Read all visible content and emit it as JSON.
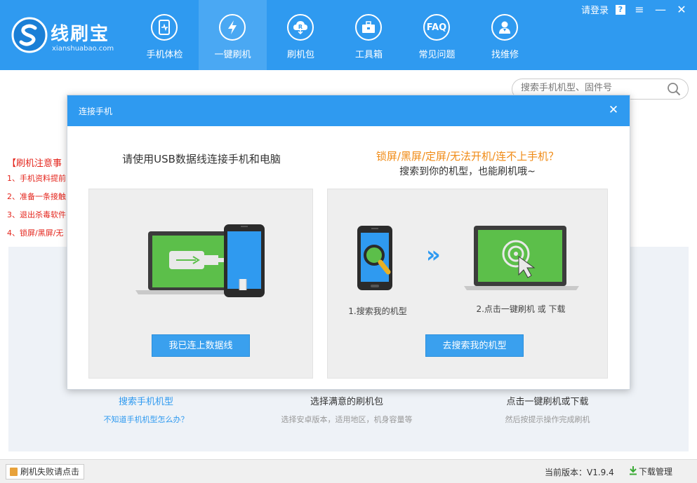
{
  "header": {
    "brand": {
      "name": "线刷宝",
      "domain": "xianshuabao.com"
    },
    "nav": [
      {
        "label": "手机体检",
        "icon": "phone-check-icon"
      },
      {
        "label": "一键刷机",
        "icon": "flash-bolt-icon"
      },
      {
        "label": "刷机包",
        "icon": "rom-package-icon"
      },
      {
        "label": "工具箱",
        "icon": "toolbox-icon"
      },
      {
        "label": "常见问题",
        "icon": "faq-icon",
        "glyph": "FAQ"
      },
      {
        "label": "找维修",
        "icon": "repair-person-icon"
      }
    ],
    "active_index": 1,
    "login": "请登录",
    "help_glyph": "?",
    "menu_glyph": "≡",
    "minimize_glyph": "—",
    "close_glyph": "✕"
  },
  "search": {
    "placeholder": "搜索手机机型、固件号"
  },
  "notes": {
    "title": "【刷机注意事",
    "items": [
      "1、手机资料提前",
      "2、准备一条接触",
      "3、退出杀毒软件",
      "4、锁屏/黑屏/无"
    ]
  },
  "steps": [
    {
      "title": "搜索手机机型",
      "sub": "不知道手机机型怎么办？"
    },
    {
      "title": "选择满意的刷机包",
      "sub": "选择安卓版本，适用地区，机身容量等"
    },
    {
      "title": "点击一键刷机或下载",
      "sub": "然后按提示操作完成刷机"
    }
  ],
  "modal": {
    "title": "连接手机",
    "close_glyph": "✕",
    "left": {
      "heading": "请使用USB数据线连接手机和电脑",
      "button": "我已连上数据线"
    },
    "right": {
      "heading_orange": "锁屏/黑屏/定屏/无法开机/连不上手机？",
      "heading_black": "搜索到你的机型，也能刷机哦~",
      "caption1": "1.搜索我的机型",
      "caption2": "2.点击一键刷机 或 下载",
      "arrow_glyph": "»",
      "button": "去搜索我的机型"
    }
  },
  "footer": {
    "fail_label": "刷机失败请点击",
    "version": "当前版本：V1.9.4",
    "download_mgr": "下载管理"
  },
  "colors": {
    "brand_blue": "#2f9af0",
    "active_tab": "#4aa8f3",
    "warning_red": "#e4251c",
    "accent_orange": "#f08a14",
    "screen_green": "#5cbf4a"
  }
}
